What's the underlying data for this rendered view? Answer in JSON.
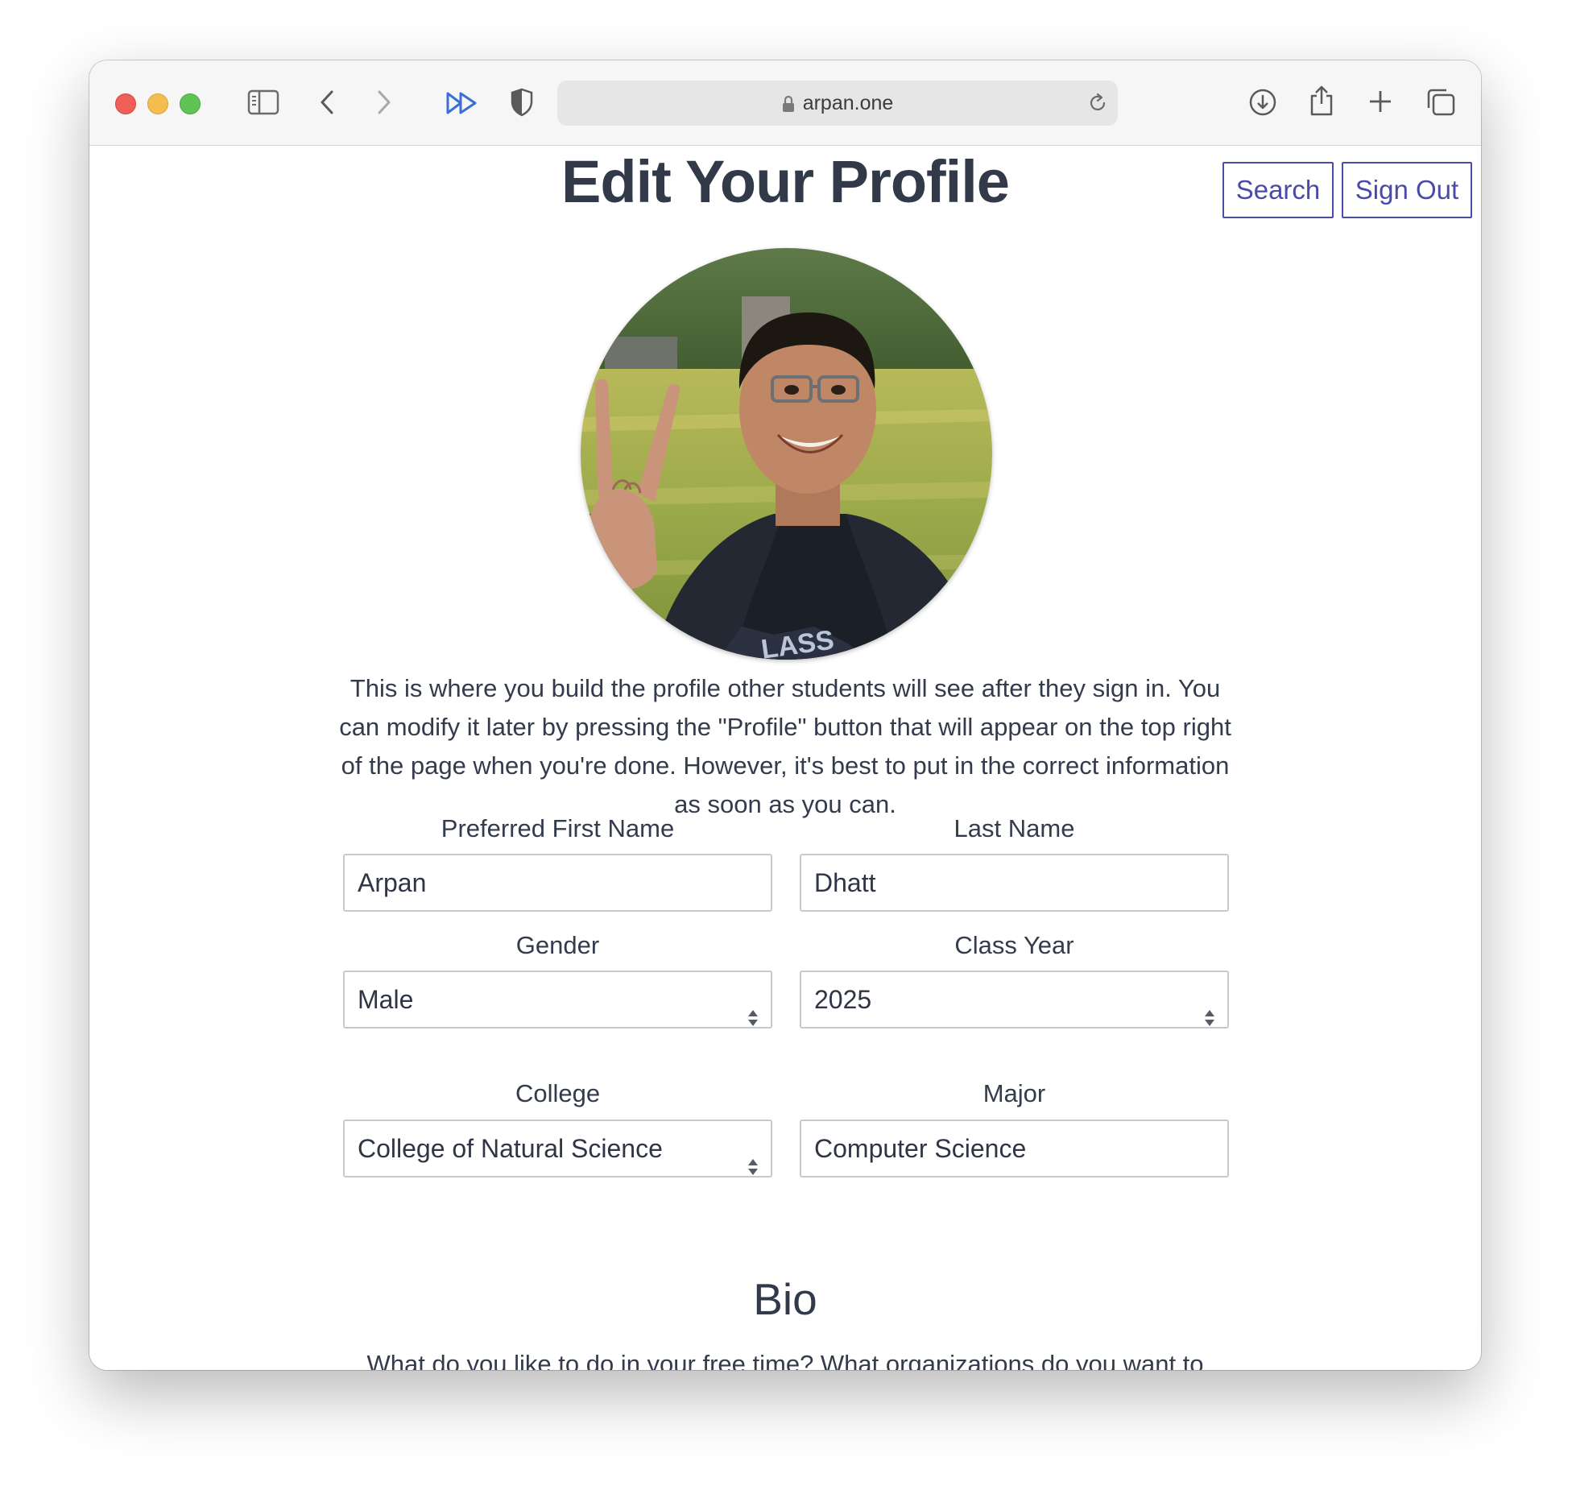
{
  "browser": {
    "url": "arpan.one",
    "icons": [
      "sidebar-icon",
      "back-icon",
      "forward-icon",
      "extension-icon",
      "privacy-shield-icon",
      "lock-icon",
      "reload-icon",
      "download-icon",
      "share-icon",
      "new-tab-icon",
      "tabs-overview-icon"
    ],
    "traffic_light_colors": {
      "close": "#ee5f58",
      "minimize": "#f5bd4f",
      "zoom": "#5fc454"
    }
  },
  "page": {
    "title": "Edit Your Profile",
    "nav": {
      "search_label": "Search",
      "signout_label": "Sign Out"
    },
    "intro": "This is where you build the profile other students will see after they sign in. You can modify it later by pressing the \"Profile\" button that will appear on the top right of the page when you're done. However, it's best to put in the correct information as soon as you can.",
    "form": {
      "first_name": {
        "label": "Preferred First Name",
        "value": "Arpan"
      },
      "last_name": {
        "label": "Last Name",
        "value": "Dhatt"
      },
      "gender": {
        "label": "Gender",
        "value": "Male"
      },
      "class_year": {
        "label": "Class Year",
        "value": "2025"
      },
      "college": {
        "label": "College",
        "value": "College of Natural Science"
      },
      "major": {
        "label": "Major",
        "value": "Computer Science"
      }
    },
    "bio": {
      "title": "Bio",
      "prompt": "What do you like to do in your free time? What organizations do you want to"
    },
    "accent_color": "#4a4aa8"
  }
}
